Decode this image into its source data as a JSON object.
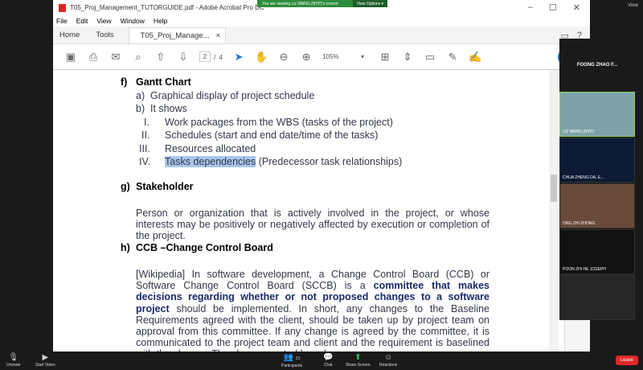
{
  "zoom": {
    "banner": "You are viewing Liz WANG (NYP)'s screen",
    "view_options": "View Options",
    "view": "View",
    "gallery_title": "FOONG ZHAO F...",
    "participants": [
      {
        "name": "LIZ WANG (NYP)"
      },
      {
        "name": "CHUA ZHENG DA, E..."
      },
      {
        "name": "ONG ZHI ZHONG"
      },
      {
        "name": "POON ZHI HE JOSEPH"
      },
      {
        "name": ""
      }
    ],
    "bottom": {
      "unmute": "Unmute",
      "start_video": "Start Video",
      "participants": "Participants",
      "participants_count": "23",
      "chat": "Chat",
      "share": "Share Screen",
      "reactions": "Reactions",
      "leave": "Leave"
    }
  },
  "acrobat": {
    "title": "T05_Proj_Management_TUTORGUIDE.pdf - Adobe Acrobat Pro DC",
    "menu": [
      "File",
      "Edit",
      "View",
      "Window",
      "Help"
    ],
    "tabs": {
      "home": "Home",
      "tools": "Tools",
      "doc": "T05_Proj_Manage...",
      "close": "×"
    },
    "page": {
      "current": "2",
      "sep": "/",
      "total": "4"
    },
    "zoom": "105%",
    "share": "S"
  },
  "doc": {
    "f_head": "f)",
    "f_title": "Gantt Chart",
    "fa_l": "a)",
    "fa": "Graphical display of project schedule",
    "fb_l": "b)",
    "fb": "It shows",
    "r1_l": "I.",
    "r1": "Work packages from the WBS (tasks of the project)",
    "r2_l": "II.",
    "r2": "Schedules (start and end date/time of the tasks)",
    "r3_l": "III.",
    "r3": "Resources allocated",
    "r4_l": "IV.",
    "r4_hl": "Tasks dependencies",
    "r4": " (Predecessor task relationships)",
    "g_head": "g)",
    "g_title": "Stakeholder",
    "g_text": "Person or organization that is actively involved in the project, or whose interests may be positively or negatively affected by execution or completion of the project.",
    "h_head": "h)",
    "h_title": "CCB –Change Control Board",
    "h_t1": "[Wikipedia] In software development, a Change Control Board (CCB) or Software Change Control Board (SCCB) is a ",
    "h_bold": "committee that makes decisions regarding whether or not proposed changes to a software project",
    "h_t2": " should be implemented. In short, any changes to the Baseline Requirements agreed with the client, should be taken up by project team on approval from this committee. If any change is agreed by the committee, it is communicated to the project team and client and the requirement is baselined with the change. The change control board"
  }
}
